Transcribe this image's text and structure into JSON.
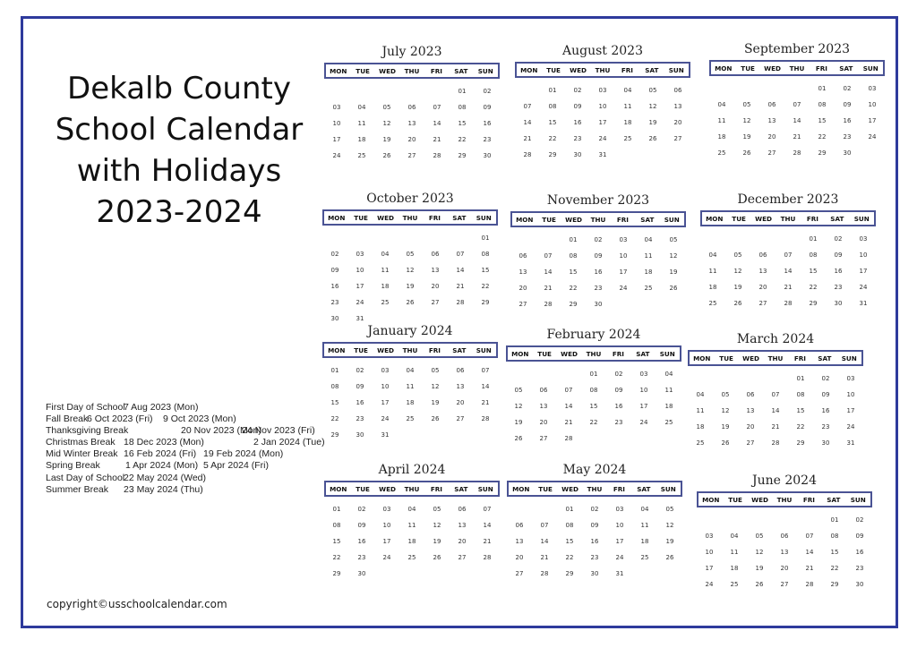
{
  "title_lines": [
    "Dekalb County",
    "School Calendar",
    "with Holidays",
    "2023-2024"
  ],
  "weekdays": [
    "MON",
    "TUE",
    "WED",
    "THU",
    "FRI",
    "SAT",
    "SUN"
  ],
  "months": [
    {
      "name": "July 2023",
      "offset": 5,
      "days": 30
    },
    {
      "name": "August 2023",
      "offset": 1,
      "days": 31
    },
    {
      "name": "September 2023",
      "offset": 4,
      "days": 30
    },
    {
      "name": "October 2023",
      "offset": 6,
      "days": 31
    },
    {
      "name": "November 2023",
      "offset": 2,
      "days": 30
    },
    {
      "name": "December 2023",
      "offset": 4,
      "days": 31
    },
    {
      "name": "January 2024",
      "offset": 0,
      "days": 31
    },
    {
      "name": "February 2024",
      "offset": 3,
      "days": 28
    },
    {
      "name": "March 2024",
      "offset": 4,
      "days": 31
    },
    {
      "name": "April 2024",
      "offset": 0,
      "days": 30
    },
    {
      "name": "May 2024",
      "offset": 2,
      "days": 31
    },
    {
      "name": "June 2024",
      "offset": 5,
      "days": 30
    }
  ],
  "holidays": [
    {
      "label": "First Day of School",
      "start": "7 Aug 2023 (Mon)",
      "end": ""
    },
    {
      "label": "Fall Break",
      "start": "6 Oct 2023 (Fri)",
      "end": "9 Oct 2023 (Mon)"
    },
    {
      "label": "Thanksgiving Break",
      "start": "20 Nov 2023 (Mon)",
      "end": "24 Nov 2023 (Fri)"
    },
    {
      "label": "Christmas Break",
      "start": "18 Dec 2023 (Mon)",
      "end": "2 Jan 2024 (Tue)"
    },
    {
      "label": "Mid Winter Break",
      "start": "16 Feb 2024 (Fri)",
      "end": "19 Feb 2024 (Mon)"
    },
    {
      "label": "Spring Break",
      "start": "1 Apr 2024 (Mon)",
      "end": "5 Apr 2024 (Fri)"
    },
    {
      "label": "Last Day of School",
      "start": "22 May 2024 (Wed)",
      "end": ""
    },
    {
      "label": "Summer Break",
      "start": "23 May 2024 (Thu)",
      "end": ""
    }
  ],
  "copyright": "copyright©usschoolcalendar.com",
  "colors": {
    "frame": "#2e3a9c",
    "weekday_box": "#4a5394"
  }
}
